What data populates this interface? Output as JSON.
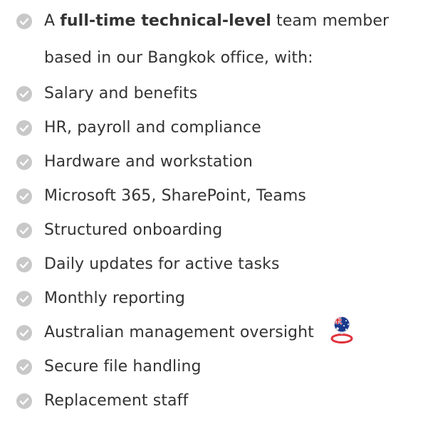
{
  "intro": {
    "prefix": "A",
    "bold": "full-time technical-level",
    "suffix": "team member based in our Bangkok office, with:"
  },
  "items": [
    {
      "label": "Salary and benefits"
    },
    {
      "label": "HR, payroll and compliance"
    },
    {
      "label": "Hardware and workstation"
    },
    {
      "label": "Microsoft 365, SharePoint, Teams"
    },
    {
      "label": "Structured onboarding"
    },
    {
      "label": "Daily updates for active tasks"
    },
    {
      "label": "Monthly reporting"
    },
    {
      "label": "Australian management oversight"
    },
    {
      "label": "Secure file handling"
    },
    {
      "label": "Replacement staff"
    }
  ],
  "colors": {
    "check_circle": "#c8c8c8",
    "check_mark": "#ffffff",
    "text": "#333333",
    "pin_ring": "#e0313b",
    "flag_blue": "#1a3a8c"
  },
  "icons": {
    "bullet": "check-circle-icon",
    "oversight": "australia-flag-pin-icon"
  }
}
